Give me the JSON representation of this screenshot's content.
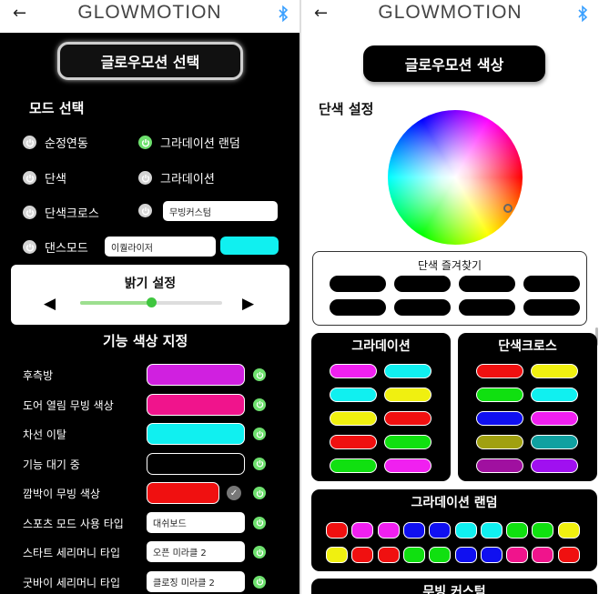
{
  "left_screen": {
    "header": {
      "back_icon": "arrow-left-icon",
      "brand": "GLOWMOTION",
      "bt_icon": "bluetooth-icon",
      "bt_color": "#3aa0ff"
    },
    "title_button": "글로우모션 선택",
    "mode_section": "모드 선택",
    "modes": [
      {
        "label": "순정연동",
        "active": false
      },
      {
        "label": "그라데이션 랜덤",
        "active": true
      },
      {
        "label": "단색",
        "active": false
      },
      {
        "label": "그라데이션",
        "active": false
      },
      {
        "label": "단색크로스",
        "active": false
      },
      {
        "label": "",
        "active": false,
        "input_value": "무빙커스텀"
      },
      {
        "label": "댄스모드",
        "active": false,
        "input_value": "이퀄라이저",
        "color": "#10f0f0"
      }
    ],
    "brightness": {
      "title": "밝기 설정",
      "left_icon": "arrow-left-icon",
      "right_icon": "arrow-right-icon",
      "level": 0.5
    },
    "function_section": "기능 색상 지정",
    "functions": [
      {
        "label": "후측방",
        "color": "#d020e0",
        "power": true
      },
      {
        "label": "도어 열림 무빙 색상",
        "color": "#f0148c",
        "power": true
      },
      {
        "label": "차선 이탈",
        "color": "#10f0f0",
        "power": true
      },
      {
        "label": "기능 대기 중",
        "color": "#000000",
        "power": true
      },
      {
        "label": "깜박이 무빙 색상",
        "color": "#f01010",
        "power": true,
        "check": true
      },
      {
        "label": "스포츠 모드 사용 타입",
        "value": "대쉬보드",
        "power": true
      },
      {
        "label": "스타트 세리머니 타입",
        "value": "오픈 미라클 2",
        "power": true
      },
      {
        "label": "굿바이 세리머니 타입",
        "value": "클로징 미라클 2",
        "power": true
      }
    ]
  },
  "right_screen": {
    "header": {
      "back_icon": "arrow-left-icon",
      "brand": "GLOWMOTION",
      "bt_icon": "bluetooth-icon"
    },
    "title_button": "글로우모션 색상",
    "solid_section": "단색 설정",
    "favorites": {
      "title": "단색 즐겨찾기",
      "slots": 8
    },
    "gradation": {
      "title": "그라데이션",
      "pairs": [
        [
          "#f020f0",
          "#10f0f0"
        ],
        [
          "#10f0f0",
          "#f0f010"
        ],
        [
          "#f0f010",
          "#f01010"
        ],
        [
          "#f01010",
          "#10e010"
        ],
        [
          "#10e010",
          "#f020f0"
        ]
      ]
    },
    "solid_cross": {
      "title": "단색크로스",
      "pairs": [
        [
          "#f01010",
          "#f0f010"
        ],
        [
          "#10e010",
          "#10f0f0"
        ],
        [
          "#1010f0",
          "#f020f0"
        ],
        [
          "#a0a010",
          "#10a0a0"
        ],
        [
          "#a010a0",
          "#a010f0"
        ]
      ]
    },
    "gradation_random": {
      "title": "그라데이션 랜덤",
      "row1": [
        "#f01010",
        "#f020f0",
        "#f020f0",
        "#1010f0",
        "#1010f0",
        "#10f0f0",
        "#10f0f0",
        "#10e010",
        "#10e010",
        "#f0f010"
      ],
      "row2": [
        "#f0f010",
        "#f01010",
        "#f01010",
        "#10e010",
        "#10e010",
        "#1010f0",
        "#1010f0",
        "#f0148c",
        "#f0148c",
        "#f01010"
      ]
    },
    "next_panel_title": "무빙 커스텀"
  }
}
